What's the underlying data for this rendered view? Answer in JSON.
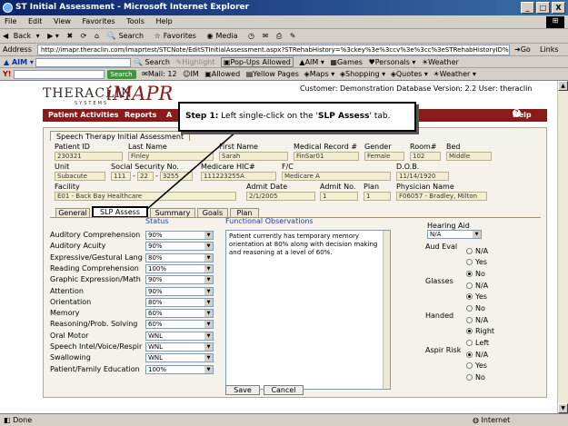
{
  "window": {
    "title": "ST Initial Assessment - Microsoft Internet Explorer",
    "controls": [
      "_",
      "□",
      "X"
    ]
  },
  "menu": [
    "File",
    "Edit",
    "View",
    "Favorites",
    "Tools",
    "Help"
  ],
  "toolbar": {
    "back": "Back",
    "search": "Search",
    "favorites": "Favorites",
    "media": "Media"
  },
  "address": {
    "label": "Address",
    "url": "http://imapr.theraclin.com/imaprtest/STCNote/EditSTInitialAssessment.aspx?STRehabHistory=%3ckey%3e%3ccv%3e%3cc%3eSTRehabHistoryID%3c",
    "go": "Go",
    "links": "Links"
  },
  "aim_bar": {
    "aim": "AIM",
    "search": "Search",
    "highlight": "Highlight",
    "popups": "Pop-Ups Allowed",
    "aim2": "AIM",
    "games": "Games",
    "personals": "Personals",
    "weather": "Weather"
  },
  "y_bar": {
    "search": "Search",
    "mail": "Mail: 12",
    "im": "IM",
    "allowed": "Allowed",
    "yellow_pages": "Yellow Pages",
    "maps": "Maps",
    "shopping": "Shopping",
    "quotes": "Quotes",
    "weather": "Weather"
  },
  "app": {
    "logo_left": "THERACLIN",
    "logo_sub": "SYSTEMS",
    "logo_right": "iMAPR",
    "customer_info": "Customer: Demonstration Database Version: 2.2 User: theraclin",
    "nav": {
      "patient_activities": "Patient Activities",
      "reports": "Reports",
      "a": "A",
      "help": "Help"
    }
  },
  "callout": {
    "step": "Step 1:",
    "text": " Left single-click on the '",
    "target": "SLP Assess",
    "end": "' tab."
  },
  "form": {
    "section_title": "Speech Therapy Initial Assessment",
    "labels": {
      "patient_id": "Patient ID",
      "last_name": "Last Name",
      "first_name": "First Name",
      "medical_record": "Medical Record #",
      "gender": "Gender",
      "room": "Room#",
      "bed": "Bed",
      "unit": "Unit",
      "ssn": "Social Security No.",
      "medicare": "Medicare HIC#",
      "fc": "F/C",
      "dob": "D.O.B.",
      "facility": "Facility",
      "admit_date": "Admit Date",
      "admit_no": "Admit No.",
      "plan": "Plan",
      "physician": "Physician Name"
    },
    "values": {
      "patient_id": "230321",
      "last_name": "Finley",
      "first_name": "Sarah",
      "medical_record": "FinSar01",
      "gender": "Female",
      "room": "102",
      "bed": "Middle",
      "unit": "Subacute",
      "ssn1": "111",
      "ssn2": "22",
      "ssn3": "3255",
      "medicare": "111223255A",
      "fc": "Medicare A",
      "dob": "11/14/1920",
      "facility": "E01 - Back Bay Healthcare",
      "admit_date": "2/1/2005",
      "admit_no": "1",
      "plan": "1",
      "physician": "F06057 - Bradley, Milton"
    },
    "tabs": [
      "General",
      "SLP Assess",
      "Summary",
      "Goals",
      "Plan"
    ],
    "status_header": "Status",
    "obs_header": "Functional Observations",
    "rows": [
      {
        "label": "Auditory Comprehension",
        "value": "90%"
      },
      {
        "label": "Auditory Acuity",
        "value": "90%"
      },
      {
        "label": "Expressive/Gestural Lang",
        "value": "80%"
      },
      {
        "label": "Reading Comprehension",
        "value": "100%"
      },
      {
        "label": "Graphic Expression/Math",
        "value": "90%"
      },
      {
        "label": "Attention",
        "value": "90%"
      },
      {
        "label": "Orientation",
        "value": "80%"
      },
      {
        "label": "Memory",
        "value": "60%"
      },
      {
        "label": "Reasoning/Prob. Solving",
        "value": "60%"
      },
      {
        "label": "Oral Motor",
        "value": "WNL"
      },
      {
        "label": "Speech Intel/Voice/Respir",
        "value": "WNL"
      },
      {
        "label": "Swallowing",
        "value": "WNL"
      },
      {
        "label": "Patient/Family Education",
        "value": "100%"
      }
    ],
    "observations": "Patient currently has temporary memory orientation at 80% along with decision making and reasoning at a level of 60%.",
    "hearing_aid": {
      "label": "Hearing Aid",
      "value": "N/A"
    },
    "aud_eval": {
      "label": "Aud Eval",
      "options": [
        "N/A",
        "Yes",
        "No"
      ],
      "selected": "No"
    },
    "glasses": {
      "label": "Glasses",
      "options": [
        "N/A",
        "Yes",
        "No"
      ],
      "selected": "Yes"
    },
    "handed": {
      "label": "Handed",
      "options": [
        "N/A",
        "Right",
        "Left"
      ],
      "selected": "Right"
    },
    "aspir_risk": {
      "label": "Aspir Risk",
      "options": [
        "N/A",
        "Yes",
        "No"
      ],
      "selected": "N/A"
    },
    "buttons": {
      "save": "Save",
      "cancel": "Cancel"
    }
  },
  "status": {
    "left": "Done",
    "zone": "Internet"
  }
}
